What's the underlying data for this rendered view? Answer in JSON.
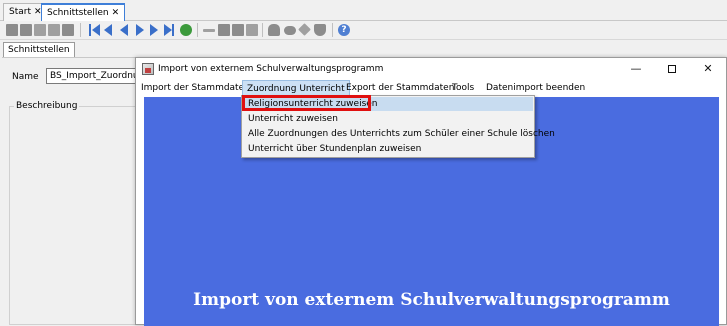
{
  "tabs": [
    {
      "label": "Start",
      "close": "✕"
    },
    {
      "label": "Schnittstellen",
      "close": "✕"
    }
  ],
  "subtab": {
    "label": "Schnittstellen"
  },
  "form": {
    "name_label": "Name",
    "name_value": "BS_Import_Zuordnung",
    "beschreibung_label": "Beschreibung"
  },
  "toolbar_icons": [
    "new-icon",
    "save-icon",
    "undo-icon",
    "delete-icon",
    "comment-icon",
    "first-icon",
    "prev-page-icon",
    "prev-icon",
    "next-icon",
    "next-page-icon",
    "last-icon",
    "refresh-icon",
    "minus-icon",
    "cut-icon",
    "copy-icon",
    "paste-icon",
    "cloud-icon",
    "ellipse-icon",
    "diamond-icon",
    "shield-icon",
    "help-icon"
  ],
  "dialog": {
    "title": "Import von externem Schulverwaltungsprogramm",
    "minimize": "—",
    "close": "✕",
    "menu": [
      "Import der Stammdaten",
      "Zuordnung Unterricht",
      "Export der Stammdaten",
      "Tools",
      "Datenimport beenden"
    ],
    "banner": "Import von externem Schulverwaltungsprogramm"
  },
  "dropdown": {
    "items": [
      "Religionsunterricht zuweisen",
      "Unterricht zuweisen",
      "Alle Zuordnungen des Unterrichts zum Schüler einer Schule löschen",
      "Unterricht über Stundenplan zuweisen"
    ]
  },
  "colors": {
    "dialog_body": "#4a6ce0",
    "highlight_box": "#e01010",
    "menu_open": "#cce0f5"
  }
}
